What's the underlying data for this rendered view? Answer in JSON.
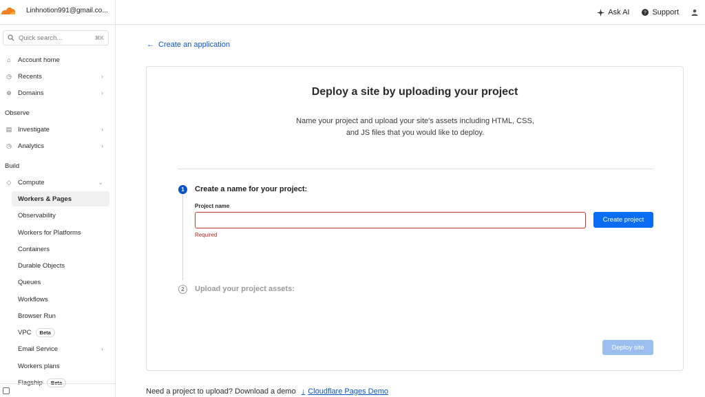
{
  "topbar": {
    "account": "Linhnotion991@gmail.co...",
    "ask_ai": "Ask AI",
    "support": "Support"
  },
  "sidebar": {
    "search": {
      "placeholder": "Quick search...",
      "shortcut": "⌘K"
    },
    "items_top": [
      {
        "label": "Account home",
        "icon": "home-icon"
      },
      {
        "label": "Recents",
        "icon": "clock-icon",
        "has_chevron": true
      },
      {
        "label": "Domains",
        "icon": "globe-icon",
        "has_chevron": true
      }
    ],
    "section_observe": "Observe",
    "items_observe": [
      {
        "label": "Investigate",
        "icon": "document-icon",
        "has_chevron": true
      },
      {
        "label": "Analytics",
        "icon": "clock-icon",
        "has_chevron": true
      }
    ],
    "section_build": "Build",
    "compute": {
      "label": "Compute",
      "icon": "diamond-icon",
      "expanded": true
    },
    "compute_children": [
      "Workers & Pages",
      "Observability",
      "Workers for Platforms",
      "Containers",
      "Durable Objects",
      "Queues",
      "Workflows",
      "Browser Run",
      "VPC",
      "Email Service",
      "Workers plans",
      "Flagship"
    ],
    "active_child": "Workers & Pages",
    "beta_label": "Beta"
  },
  "main": {
    "back_link": "Create an application",
    "card": {
      "title": "Deploy a site by uploading your project",
      "description_line1": "Name your project and upload your site's assets including HTML, CSS,",
      "description_line2": "and JS files that you would like to deploy.",
      "step1": {
        "number": "1",
        "title": "Create a name for your project:"
      },
      "field_label": "Project name",
      "field_value": "",
      "field_error": "Required",
      "create_button": "Create project",
      "step2": {
        "number": "2",
        "title": "Upload your project assets:"
      },
      "deploy_button": "Deploy site"
    },
    "footer_text": "Need a project to upload? Download a demo",
    "footer_link": "Cloudflare Pages Demo"
  },
  "colors": {
    "accent": "#0a6cf2",
    "link": "#0a55c5",
    "error": "#c0392b",
    "cloudflare_orange": "#f38020"
  }
}
